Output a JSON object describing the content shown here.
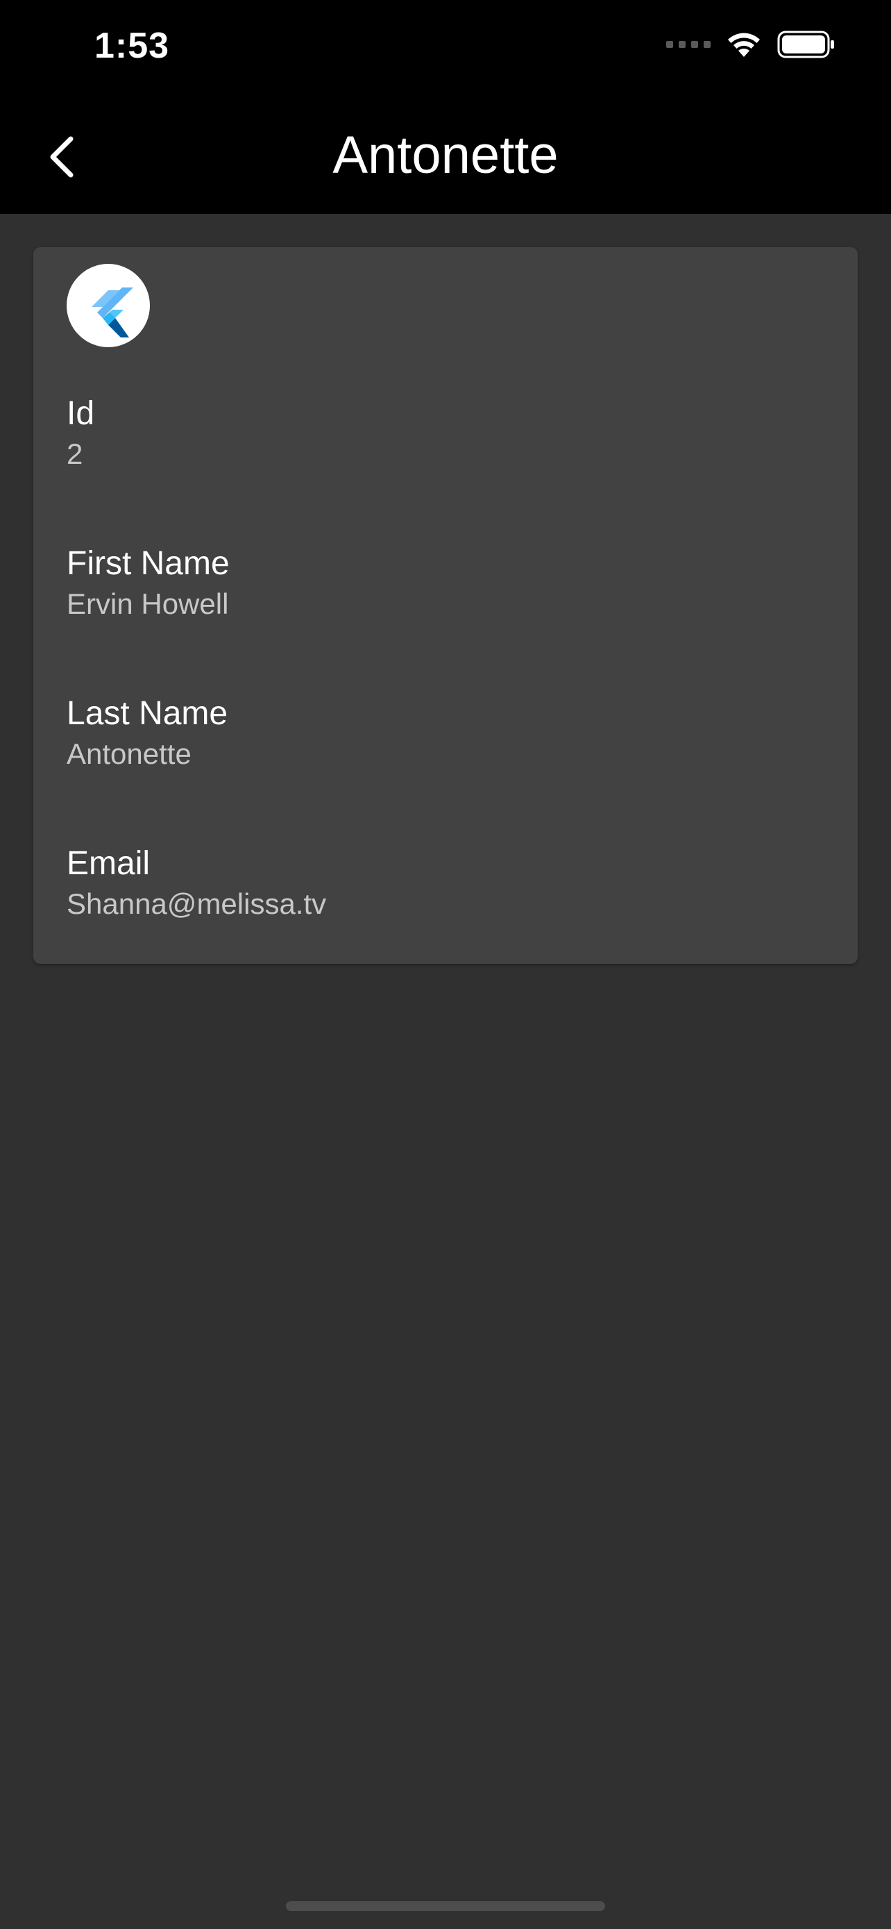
{
  "status_bar": {
    "time": "1:53"
  },
  "app_bar": {
    "title": "Antonette",
    "back_icon": "chevron-left-icon"
  },
  "profile": {
    "avatar_icon": "flutter-logo",
    "fields": [
      {
        "label": "Id",
        "value": "2"
      },
      {
        "label": "First Name",
        "value": "Ervin Howell"
      },
      {
        "label": "Last Name",
        "value": "Antonette"
      },
      {
        "label": "Email",
        "value": "Shanna@melissa.tv"
      }
    ]
  },
  "colors": {
    "background": "#303030",
    "card": "#424242",
    "top_bar": "#000000",
    "label_text": "#ffffff",
    "value_text": "#c8c8c8"
  }
}
